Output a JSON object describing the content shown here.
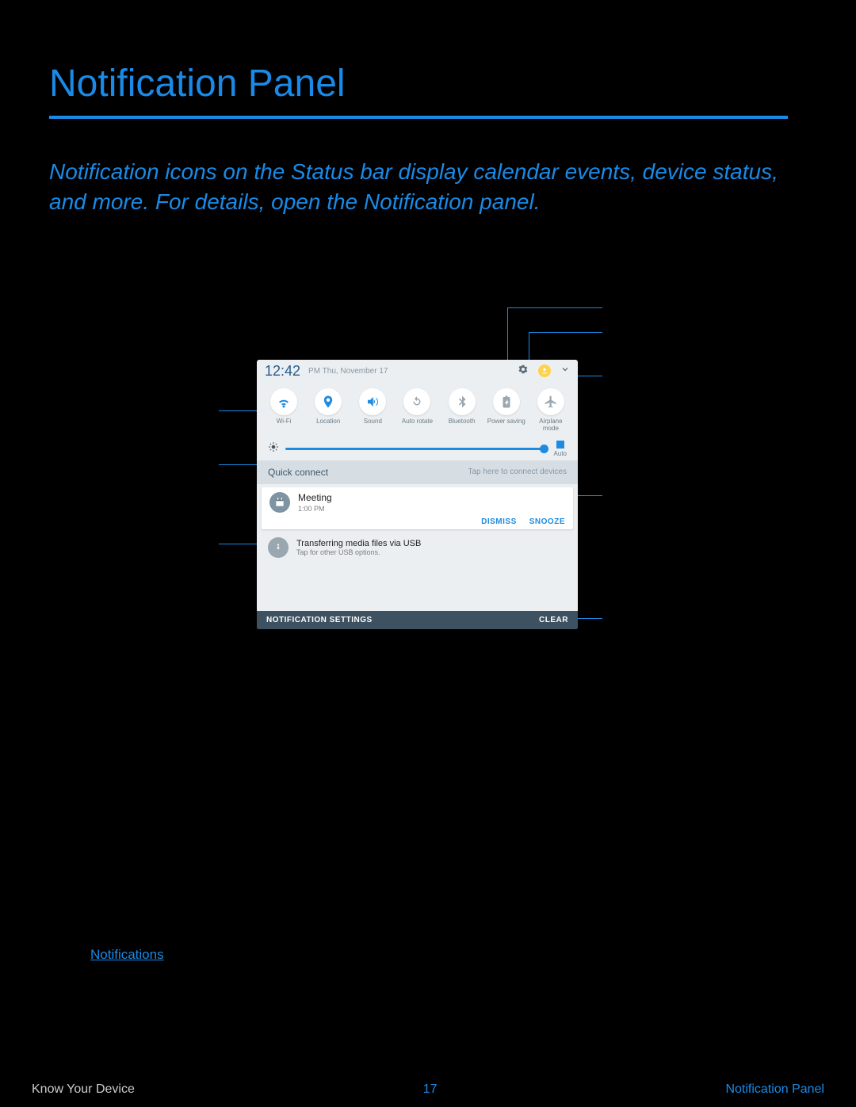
{
  "page": {
    "title": "Notification Panel",
    "intro": "Notification icons on the Status bar display calendar events, device status, and more. For details, open the Notification panel.",
    "link_label": "Notifications"
  },
  "phone": {
    "time": "12:42",
    "time_suffix": "PM  Thu, November 17",
    "quick_settings": [
      {
        "label": "Wi-Fi",
        "active": true
      },
      {
        "label": "Location",
        "active": true
      },
      {
        "label": "Sound",
        "active": true
      },
      {
        "label": "Auto rotate",
        "active": false
      },
      {
        "label": "Bluetooth",
        "active": false
      },
      {
        "label": "Power saving",
        "active": false
      },
      {
        "label": "Airplane mode",
        "active": false
      }
    ],
    "brightness_auto": "Auto",
    "quick_connect": {
      "title": "Quick connect",
      "hint": "Tap here to connect devices"
    },
    "notif1": {
      "title": "Meeting",
      "sub": "1:00 PM",
      "action_dismiss": "DISMISS",
      "action_snooze": "SNOOZE"
    },
    "notif2": {
      "title": "Transferring media files via USB",
      "sub": "Tap for other USB options."
    },
    "footer": {
      "left": "NOTIFICATION SETTINGS",
      "right": "CLEAR"
    }
  },
  "footer": {
    "left": "Know Your Device",
    "center": "17",
    "right": "Notification Panel"
  }
}
